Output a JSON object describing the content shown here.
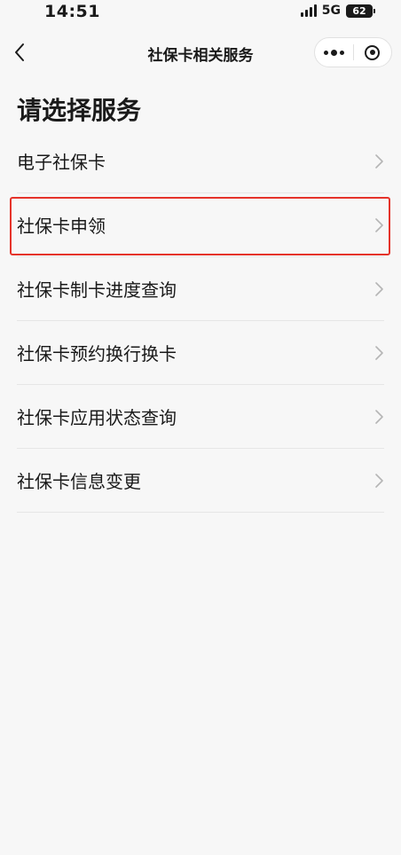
{
  "status_bar": {
    "time": "14:51",
    "network": "5G",
    "battery": "62"
  },
  "nav": {
    "title": "社保卡相关服务",
    "back_icon": "chevron-left-icon",
    "more_icon": "more-dots-icon",
    "close_icon": "record-circle-icon"
  },
  "page": {
    "heading": "请选择服务"
  },
  "services": [
    {
      "label": "电子社保卡",
      "highlighted": false
    },
    {
      "label": "社保卡申领",
      "highlighted": true
    },
    {
      "label": "社保卡制卡进度查询",
      "highlighted": false
    },
    {
      "label": "社保卡预约换行换卡",
      "highlighted": false
    },
    {
      "label": "社保卡应用状态查询",
      "highlighted": false
    },
    {
      "label": "社保卡信息变更",
      "highlighted": false
    }
  ],
  "colors": {
    "background": "#f7f7f7",
    "highlight_border": "#e5332a",
    "chevron": "#b5b5b5",
    "divider": "#e6e6e6"
  }
}
